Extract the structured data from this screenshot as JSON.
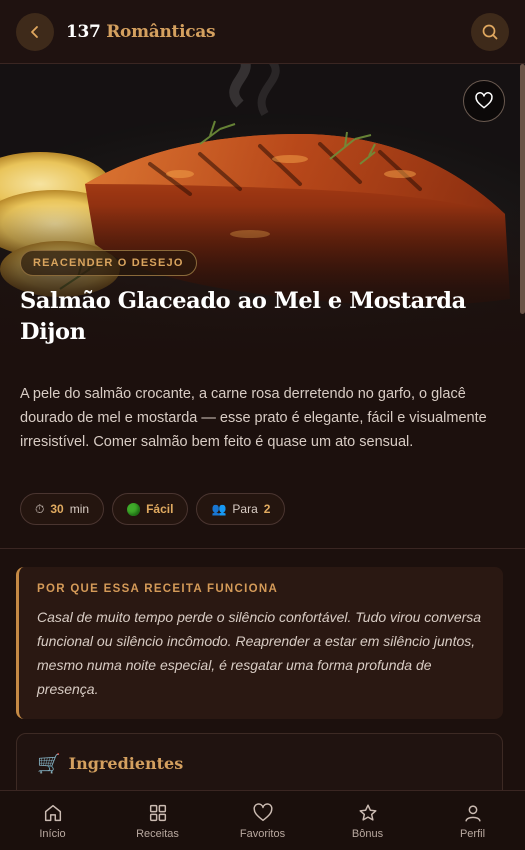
{
  "header": {
    "title_number": "137",
    "title_word": "Românticas",
    "back_icon": "chevron-left-icon",
    "search_icon": "search-icon"
  },
  "hero": {
    "category": "REACENDER O DESEJO",
    "title": "Salmão Glaceado ao Mel e Mostarda Dijon",
    "favorite_icon": "heart-icon"
  },
  "description": "A pele do salmão crocante, a carne rosa derretendo no garfo, o glacê dourado de mel e mostarda — esse prato é elegante, fácil e visualmente irresistível. Comer salmão bem feito é quase um ato sensual.",
  "chips": {
    "time_icon": "⏱",
    "time_value": "30",
    "time_unit": "min",
    "difficulty": "Fácil",
    "servings_icon": "👥",
    "servings_prefix": "Para",
    "servings_value": "2"
  },
  "why": {
    "heading": "POR QUE ESSA RECEITA FUNCIONA",
    "text": "Casal de muito tempo perde o silêncio confortável. Tudo virou conversa funcional ou silêncio incômodo. Reaprender a estar em silêncio juntos, mesmo numa noite especial, é resgatar uma forma profunda de presença."
  },
  "ingredients": {
    "icon": "🛒",
    "title": "Ingredientes"
  },
  "nav": [
    {
      "label": "Início",
      "icon": "home-icon"
    },
    {
      "label": "Receitas",
      "icon": "grid-icon"
    },
    {
      "label": "Favoritos",
      "icon": "heart-icon"
    },
    {
      "label": "Bônus",
      "icon": "star-icon"
    },
    {
      "label": "Perfil",
      "icon": "user-icon"
    }
  ],
  "colors": {
    "background": "#1c100d",
    "accent": "#d4a05f",
    "card": "#2a1812"
  }
}
